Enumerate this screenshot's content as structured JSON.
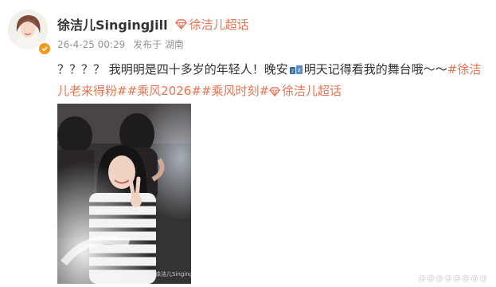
{
  "post": {
    "author": "徐洁儿SingingJill",
    "supertopic_link": "徐洁儿超话",
    "timestamp": "26-4-25 00:29",
    "source": "发布于 湖南",
    "text_before_icon": "？？？？ 我明明是四十多岁的年轻人！晚安",
    "inline_icon": "sleeping-emoji-icon",
    "text_after_icon": "明天记得看我的舞台哦～～",
    "tags": [
      "#徐洁儿老来得粉#",
      "#乘风2026#",
      "#乘风时刻#"
    ],
    "supertopic_tag": "徐洁儿超话",
    "photo_watermark": "@徐洁儿SingingJill",
    "bottom_watermark": "@@@@@@@@"
  },
  "colors": {
    "accent": "#eb7350",
    "meta_gray": "#939393",
    "badge_orange": "#f39a18"
  }
}
